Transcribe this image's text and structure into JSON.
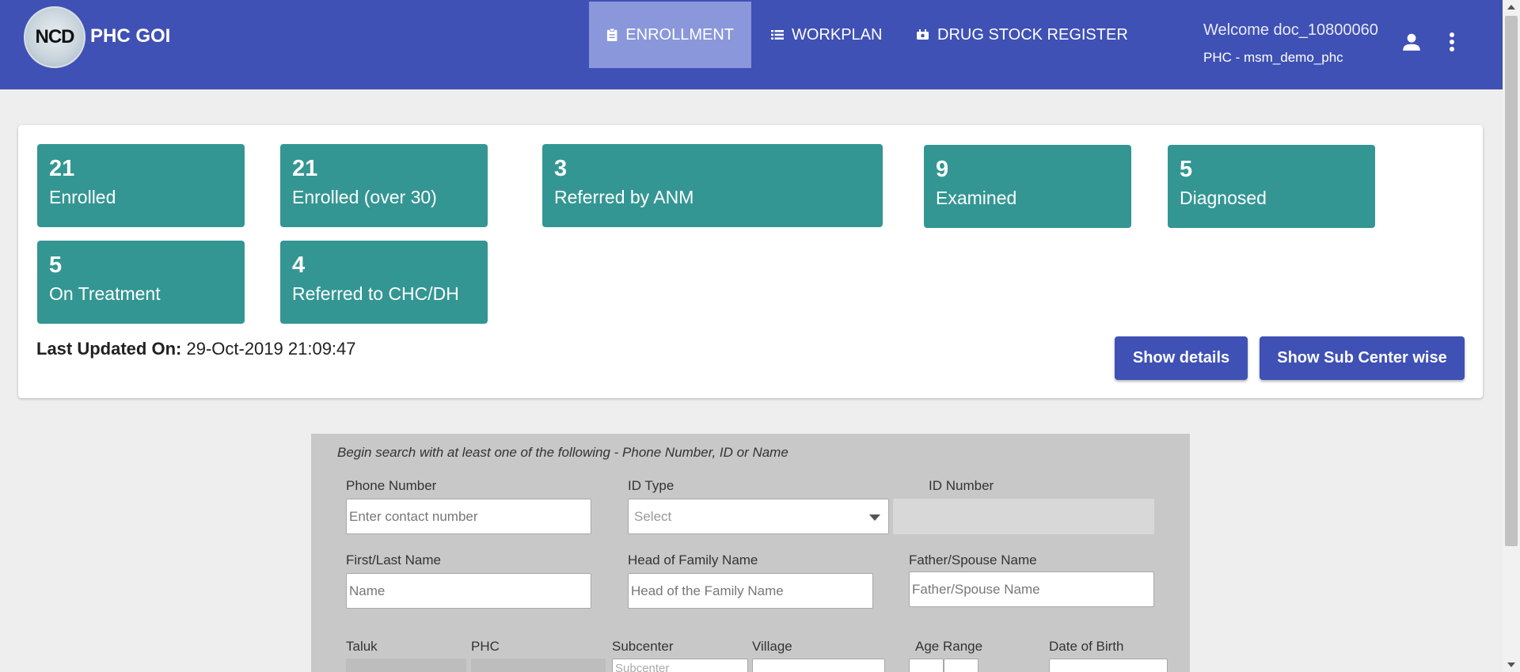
{
  "header": {
    "logo_text": "NCD",
    "app_title": "PHC GOI",
    "nav": [
      {
        "label": "ENROLLMENT",
        "icon": "clipboard-icon",
        "active": true
      },
      {
        "label": "WORKPLAN",
        "icon": "list-icon",
        "active": false
      },
      {
        "label": "DRUG STOCK REGISTER",
        "icon": "pill-icon",
        "active": false
      }
    ],
    "welcome": "Welcome doc_10800060",
    "phc": "PHC - msm_demo_phc"
  },
  "colors": {
    "primary": "#3f51b5",
    "tile": "#339693",
    "nav_active": "#8a97db",
    "panel": "#c9c8c8"
  },
  "stats": [
    {
      "value": "21",
      "label": "Enrolled"
    },
    {
      "value": "21",
      "label": "Enrolled (over 30)"
    },
    {
      "value": "3",
      "label": "Referred by ANM"
    },
    {
      "value": "9",
      "label": "Examined"
    },
    {
      "value": "5",
      "label": "Diagnosed"
    },
    {
      "value": "5",
      "label": "On Treatment"
    },
    {
      "value": "4",
      "label": "Referred to CHC/DH"
    }
  ],
  "last_updated": {
    "label": "Last Updated On:",
    "value": "29-Oct-2019 21:09:47"
  },
  "buttons": {
    "show_details": "Show details",
    "show_subcenter": "Show Sub Center wise"
  },
  "search": {
    "hint": "Begin search with at least one of the following - Phone Number, ID or Name",
    "phone_label": "Phone Number",
    "phone_placeholder": "Enter contact number",
    "id_type_label": "ID Type",
    "id_type_value": "Select",
    "id_number_label": "ID Number",
    "name_label": "First/Last Name",
    "name_placeholder": "Name",
    "hof_label": "Head of Family Name",
    "hof_placeholder": "Head of the Family Name",
    "spouse_label": "Father/Spouse Name",
    "spouse_placeholder": "Father/Spouse Name",
    "taluk_label": "Taluk",
    "phc_label": "PHC",
    "subcenter_label": "Subcenter",
    "subcenter_placeholder": "Subcenter",
    "village_label": "Village",
    "age_label": "Age Range",
    "dob_label": "Date of Birth"
  }
}
